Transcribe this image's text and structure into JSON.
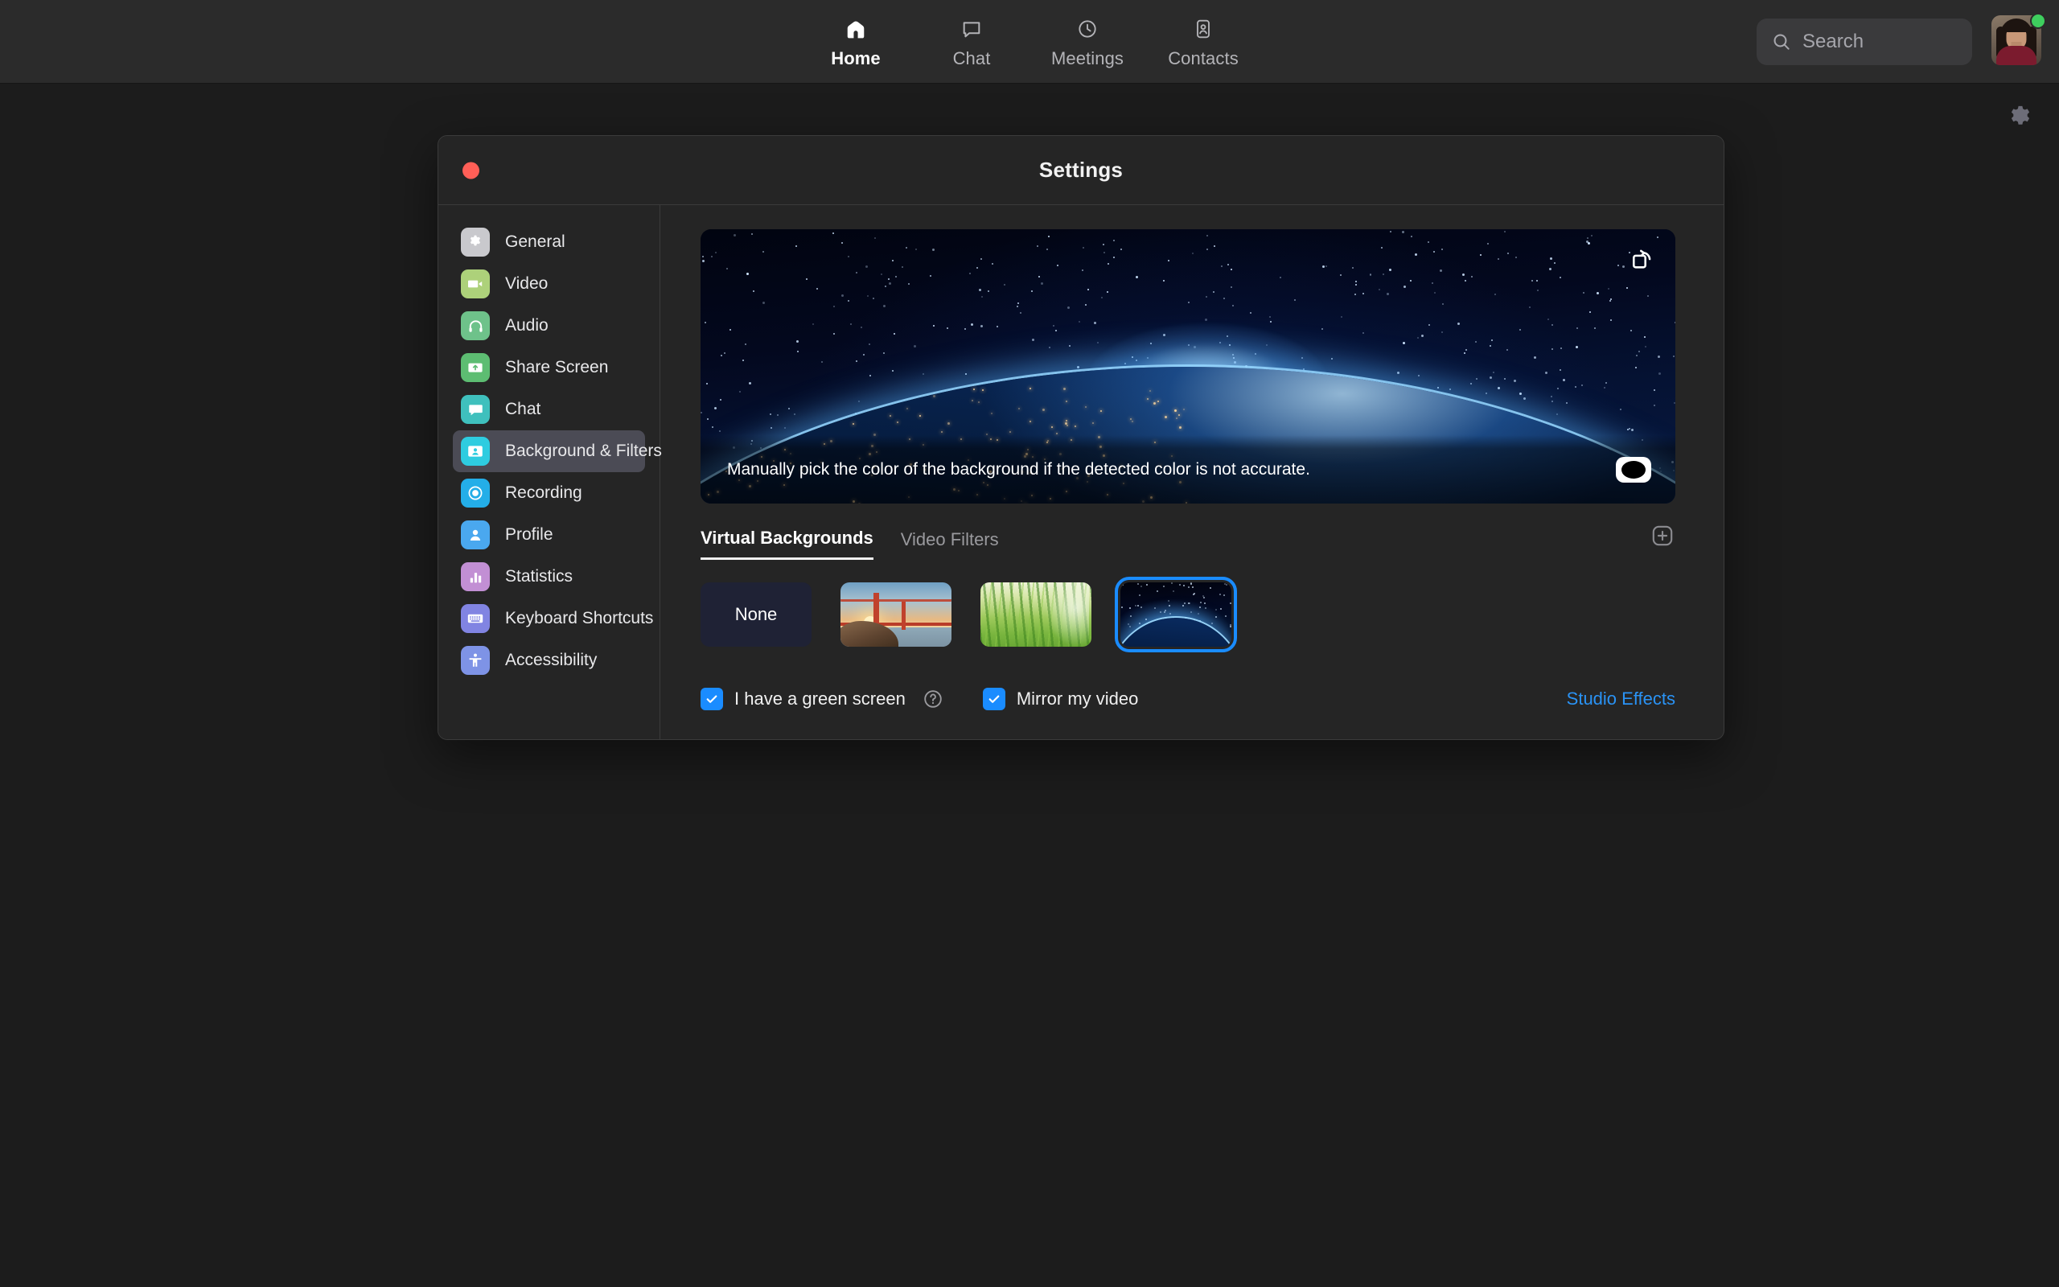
{
  "topnav": {
    "items": [
      {
        "label": "Home",
        "icon": "home-icon",
        "active": true
      },
      {
        "label": "Chat",
        "icon": "chat-bubble-icon",
        "active": false
      },
      {
        "label": "Meetings",
        "icon": "clock-icon",
        "active": false
      },
      {
        "label": "Contacts",
        "icon": "contact-card-icon",
        "active": false
      }
    ],
    "search_placeholder": "Search",
    "gear_icon": "gear-icon",
    "status_color": "#3ecf5e"
  },
  "window": {
    "title": "Settings",
    "close_color": "#ff5f57"
  },
  "sidebar": {
    "items": [
      {
        "label": "General",
        "icon": "gear-icon",
        "color": "#c9c9cd",
        "active": false
      },
      {
        "label": "Video",
        "icon": "video-camera-icon",
        "color": "#add17a",
        "active": false
      },
      {
        "label": "Audio",
        "icon": "headphones-icon",
        "color": "#6ec28a",
        "active": false
      },
      {
        "label": "Share Screen",
        "icon": "share-screen-icon",
        "color": "#5dbd72",
        "active": false
      },
      {
        "label": "Chat",
        "icon": "chat-bubble-icon",
        "color": "#3fc0bd",
        "active": false
      },
      {
        "label": "Background & Filters",
        "icon": "person-frame-icon",
        "color": "#2ecce0",
        "active": true
      },
      {
        "label": "Recording",
        "icon": "record-circle-icon",
        "color": "#24aee8",
        "active": false
      },
      {
        "label": "Profile",
        "icon": "person-icon",
        "color": "#4aa8ef",
        "active": false
      },
      {
        "label": "Statistics",
        "icon": "bar-chart-icon",
        "color": "#c28fd4",
        "active": false
      },
      {
        "label": "Keyboard Shortcuts",
        "icon": "keyboard-icon",
        "color": "#8184e2",
        "active": false
      },
      {
        "label": "Accessibility",
        "icon": "accessibility-icon",
        "color": "#7e93e6",
        "active": false
      }
    ]
  },
  "preview": {
    "rotate_icon": "rotate-icon",
    "tooltip": "Manually pick the color of the background if the detected color is not accurate.",
    "swatch_icon": "color-swatch-icon"
  },
  "tabs": {
    "items": [
      {
        "label": "Virtual Backgrounds",
        "active": true
      },
      {
        "label": "Video Filters",
        "active": false
      }
    ],
    "add_icon": "plus-icon"
  },
  "backgrounds": {
    "items": [
      {
        "label": "None",
        "kind": "none",
        "selected": false
      },
      {
        "label": "Golden Gate Bridge",
        "kind": "bridge",
        "selected": false
      },
      {
        "label": "Grass",
        "kind": "grass",
        "selected": false
      },
      {
        "label": "Earth from Space",
        "kind": "earth",
        "selected": true
      }
    ],
    "selected_color": "#1a8cff"
  },
  "footer": {
    "green_screen_label": "I have a green screen",
    "green_screen_checked": true,
    "help_icon": "question-circle-icon",
    "mirror_label": "Mirror my video",
    "mirror_checked": true,
    "studio_effects_label": "Studio Effects",
    "link_color": "#2a93f5"
  }
}
